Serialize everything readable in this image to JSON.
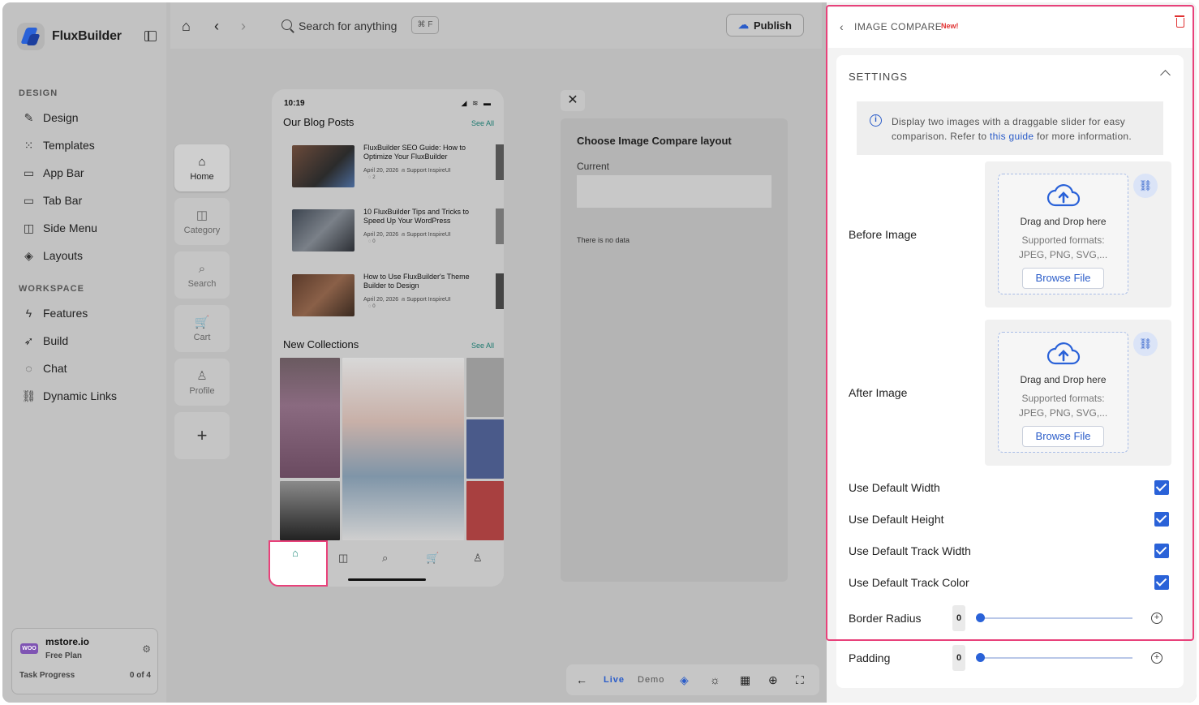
{
  "app": {
    "name": "FluxBuilder"
  },
  "sidebar": {
    "design_label": "DESIGN",
    "design_items": [
      {
        "label": "Design",
        "icon": "brush-icon"
      },
      {
        "label": "Templates",
        "icon": "grid-icon"
      },
      {
        "label": "App Bar",
        "icon": "appbar-icon"
      },
      {
        "label": "Tab Bar",
        "icon": "tabbar-icon"
      },
      {
        "label": "Side Menu",
        "icon": "sidemenu-icon"
      },
      {
        "label": "Layouts",
        "icon": "layers-icon"
      }
    ],
    "workspace_label": "WORKSPACE",
    "workspace_items": [
      {
        "label": "Features",
        "icon": "bolt-icon"
      },
      {
        "label": "Build",
        "icon": "rocket-icon"
      },
      {
        "label": "Chat",
        "icon": "chat-icon"
      },
      {
        "label": "Dynamic Links",
        "icon": "link-icon"
      }
    ],
    "store": {
      "badge": "WOO",
      "name": "mstore.io",
      "plan": "Free Plan",
      "task_label": "Task Progress",
      "task_value": "0 of 4"
    }
  },
  "topbar": {
    "search_placeholder": "Search for anything",
    "shortcut": "⌘ F",
    "publish_label": "Publish"
  },
  "rail": [
    {
      "label": "Home",
      "icon": "home-icon",
      "active": true
    },
    {
      "label": "Category",
      "icon": "category-icon",
      "active": false
    },
    {
      "label": "Search",
      "icon": "search-icon",
      "active": false
    },
    {
      "label": "Cart",
      "icon": "cart-icon",
      "active": false
    },
    {
      "label": "Profile",
      "icon": "profile-icon",
      "active": false
    },
    {
      "label": "+",
      "icon": "plus-icon",
      "active": false
    }
  ],
  "phone": {
    "time": "10:19",
    "blog_title": "Our Blog Posts",
    "see_all": "See All",
    "posts": [
      {
        "title": "FluxBuilder SEO Guide: How to Optimize Your FluxBuilder",
        "date": "April 20, 2026",
        "author": "Support InspireUI",
        "comments": "2"
      },
      {
        "title": "10 FluxBuilder Tips and Tricks to Speed Up Your WordPress",
        "date": "April 20, 2026",
        "author": "Support InspireUI",
        "comments": "0"
      },
      {
        "title": "How to Use FluxBuilder's Theme Builder to Design",
        "date": "April 20, 2026",
        "author": "Support InspireUI",
        "comments": "0"
      }
    ],
    "collections_title": "New Collections"
  },
  "layout_panel": {
    "title": "Choose Image Compare layout",
    "current_label": "Current",
    "empty_text": "There is no data"
  },
  "bottom_toolbar": {
    "live": "Live",
    "demo": "Demo"
  },
  "right_panel": {
    "title": "IMAGE COMPARE",
    "new_badge": "New!",
    "settings_title": "SETTINGS",
    "info_text_before": "Display two images with a draggable slider for easy comparison. Refer to ",
    "info_link": "this guide",
    "info_text_after": " for more information.",
    "before_label": "Before Image",
    "after_label": "After Image",
    "drag_text": "Drag and Drop here",
    "formats_text": "Supported formats: JPEG, PNG, SVG,...",
    "browse_label": "Browse File",
    "checks": [
      {
        "label": "Use Default Width",
        "checked": true
      },
      {
        "label": "Use Default Height",
        "checked": true
      },
      {
        "label": "Use Default Track Width",
        "checked": true
      },
      {
        "label": "Use Default Track Color",
        "checked": true
      }
    ],
    "border_radius": {
      "label": "Border Radius",
      "value": "0"
    },
    "padding": {
      "label": "Padding",
      "value": "0"
    }
  },
  "colors": {
    "accent": "#2a62d8",
    "highlight": "#e8417a",
    "new_badge": "#e03131",
    "link": "#2a5cc9"
  }
}
